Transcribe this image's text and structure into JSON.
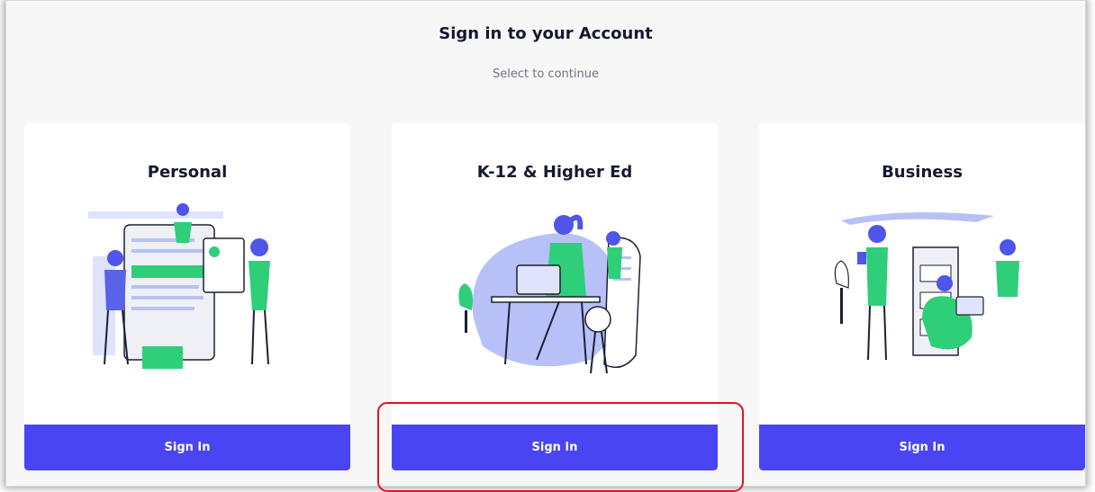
{
  "header": {
    "title": "Sign in to your Account",
    "subtitle": "Select to continue"
  },
  "cards": [
    {
      "title": "Personal",
      "button_label": "Sign In",
      "illustration": "personal-illustration"
    },
    {
      "title": "K-12 & Higher Ed",
      "button_label": "Sign In",
      "illustration": "education-illustration"
    },
    {
      "title": "Business",
      "button_label": "Sign In",
      "illustration": "business-illustration"
    }
  ],
  "colors": {
    "accent": "#4a45f3",
    "illustration_blue": "#4f55e8",
    "illustration_green": "#2fcf7a",
    "illustration_light": "#b7c1f7",
    "highlight": "#e0141e"
  }
}
